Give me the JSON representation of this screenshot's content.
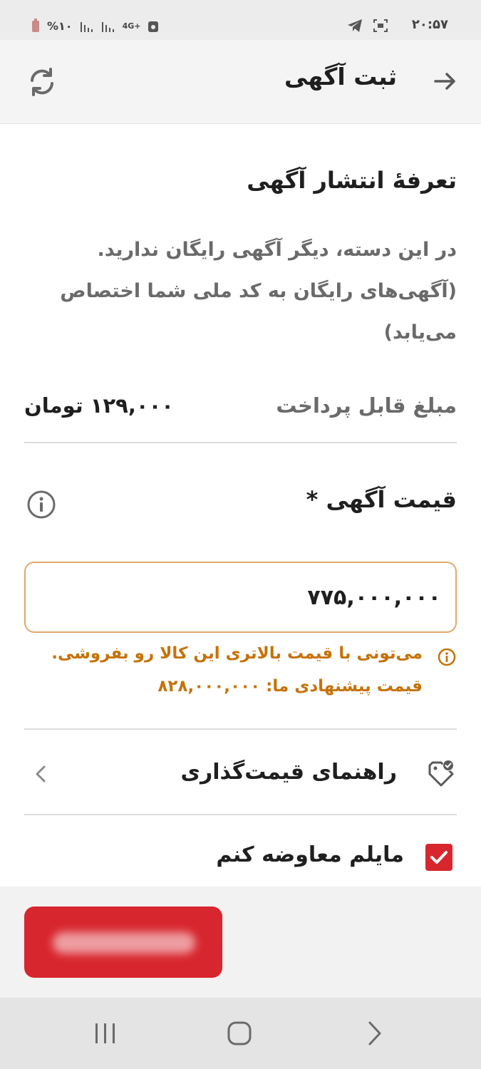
{
  "status_bar": {
    "time": "۲۰:۵۷",
    "battery": "%۱۰",
    "network": "4G+"
  },
  "header": {
    "title": "ثبت آگهی",
    "back_icon": "arrow-right-icon",
    "refresh_icon": "refresh-icon"
  },
  "tariff": {
    "title": "تعرفهٔ انتشار آگهی",
    "description_lines": [
      "در این دسته، دیگر آگهی رایگان ندارید.",
      "(آگهی‌های رایگان به کد ملی شما اختصاص",
      "می‌یابد)"
    ],
    "payable_label": "مبلغ قابل پرداخت",
    "payable_value": "۱۲۹,۰۰۰ تومان"
  },
  "price": {
    "heading": "قیمت آگهی *",
    "input_value": "۷۷۵,۰۰۰,۰۰۰",
    "warning_line1": "می‌تونی با قیمت بالاتری این کالا رو بفروشی.",
    "warning_line2": "قیمت پیشنهادی ما: ۸۲۸,۰۰۰,۰۰۰",
    "warning_color": "#c6720a"
  },
  "pricing_guide": {
    "label": "راهنمای قیمت‌گذاری"
  },
  "exchange": {
    "label": "مایلم معاوضه کنم",
    "checked": true
  },
  "footer": {
    "submit_color": "#d8262e"
  }
}
